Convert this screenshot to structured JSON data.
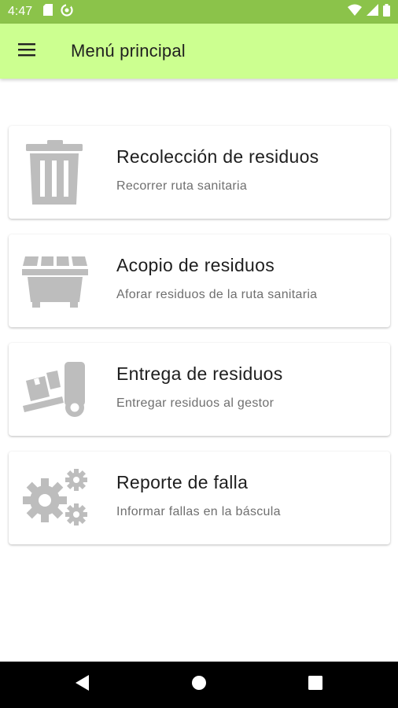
{
  "status_bar": {
    "time": "4:47",
    "left_icons": [
      "sd-card-icon",
      "sync-icon"
    ],
    "right_icons": [
      "wifi-icon",
      "signal-icon",
      "battery-icon"
    ],
    "background": "#8bc34a"
  },
  "app_bar": {
    "title": "Menú principal",
    "menu_icon": "hamburger-menu-icon",
    "background": "#ccff90"
  },
  "menu_items": [
    {
      "title": "Recolección de residuos",
      "subtitle": "Recorrer ruta sanitaria",
      "icon": "trash-can-icon"
    },
    {
      "title": "Acopio de residuos",
      "subtitle": "Aforar residuos de la ruta sanitaria",
      "icon": "dumpster-icon"
    },
    {
      "title": "Entrega de residuos",
      "subtitle": "Entregar residuos al gestor",
      "icon": "hand-truck-icon"
    },
    {
      "title": "Reporte de falla",
      "subtitle": "Informar fallas en la báscula",
      "icon": "gears-icon"
    }
  ],
  "nav_bar": {
    "buttons": [
      "back-icon",
      "home-icon",
      "recents-icon"
    ]
  },
  "colors": {
    "icon_gray": "#bdbdbd",
    "title_text": "#1e1e1e",
    "subtitle_text": "#6f6f6f"
  }
}
